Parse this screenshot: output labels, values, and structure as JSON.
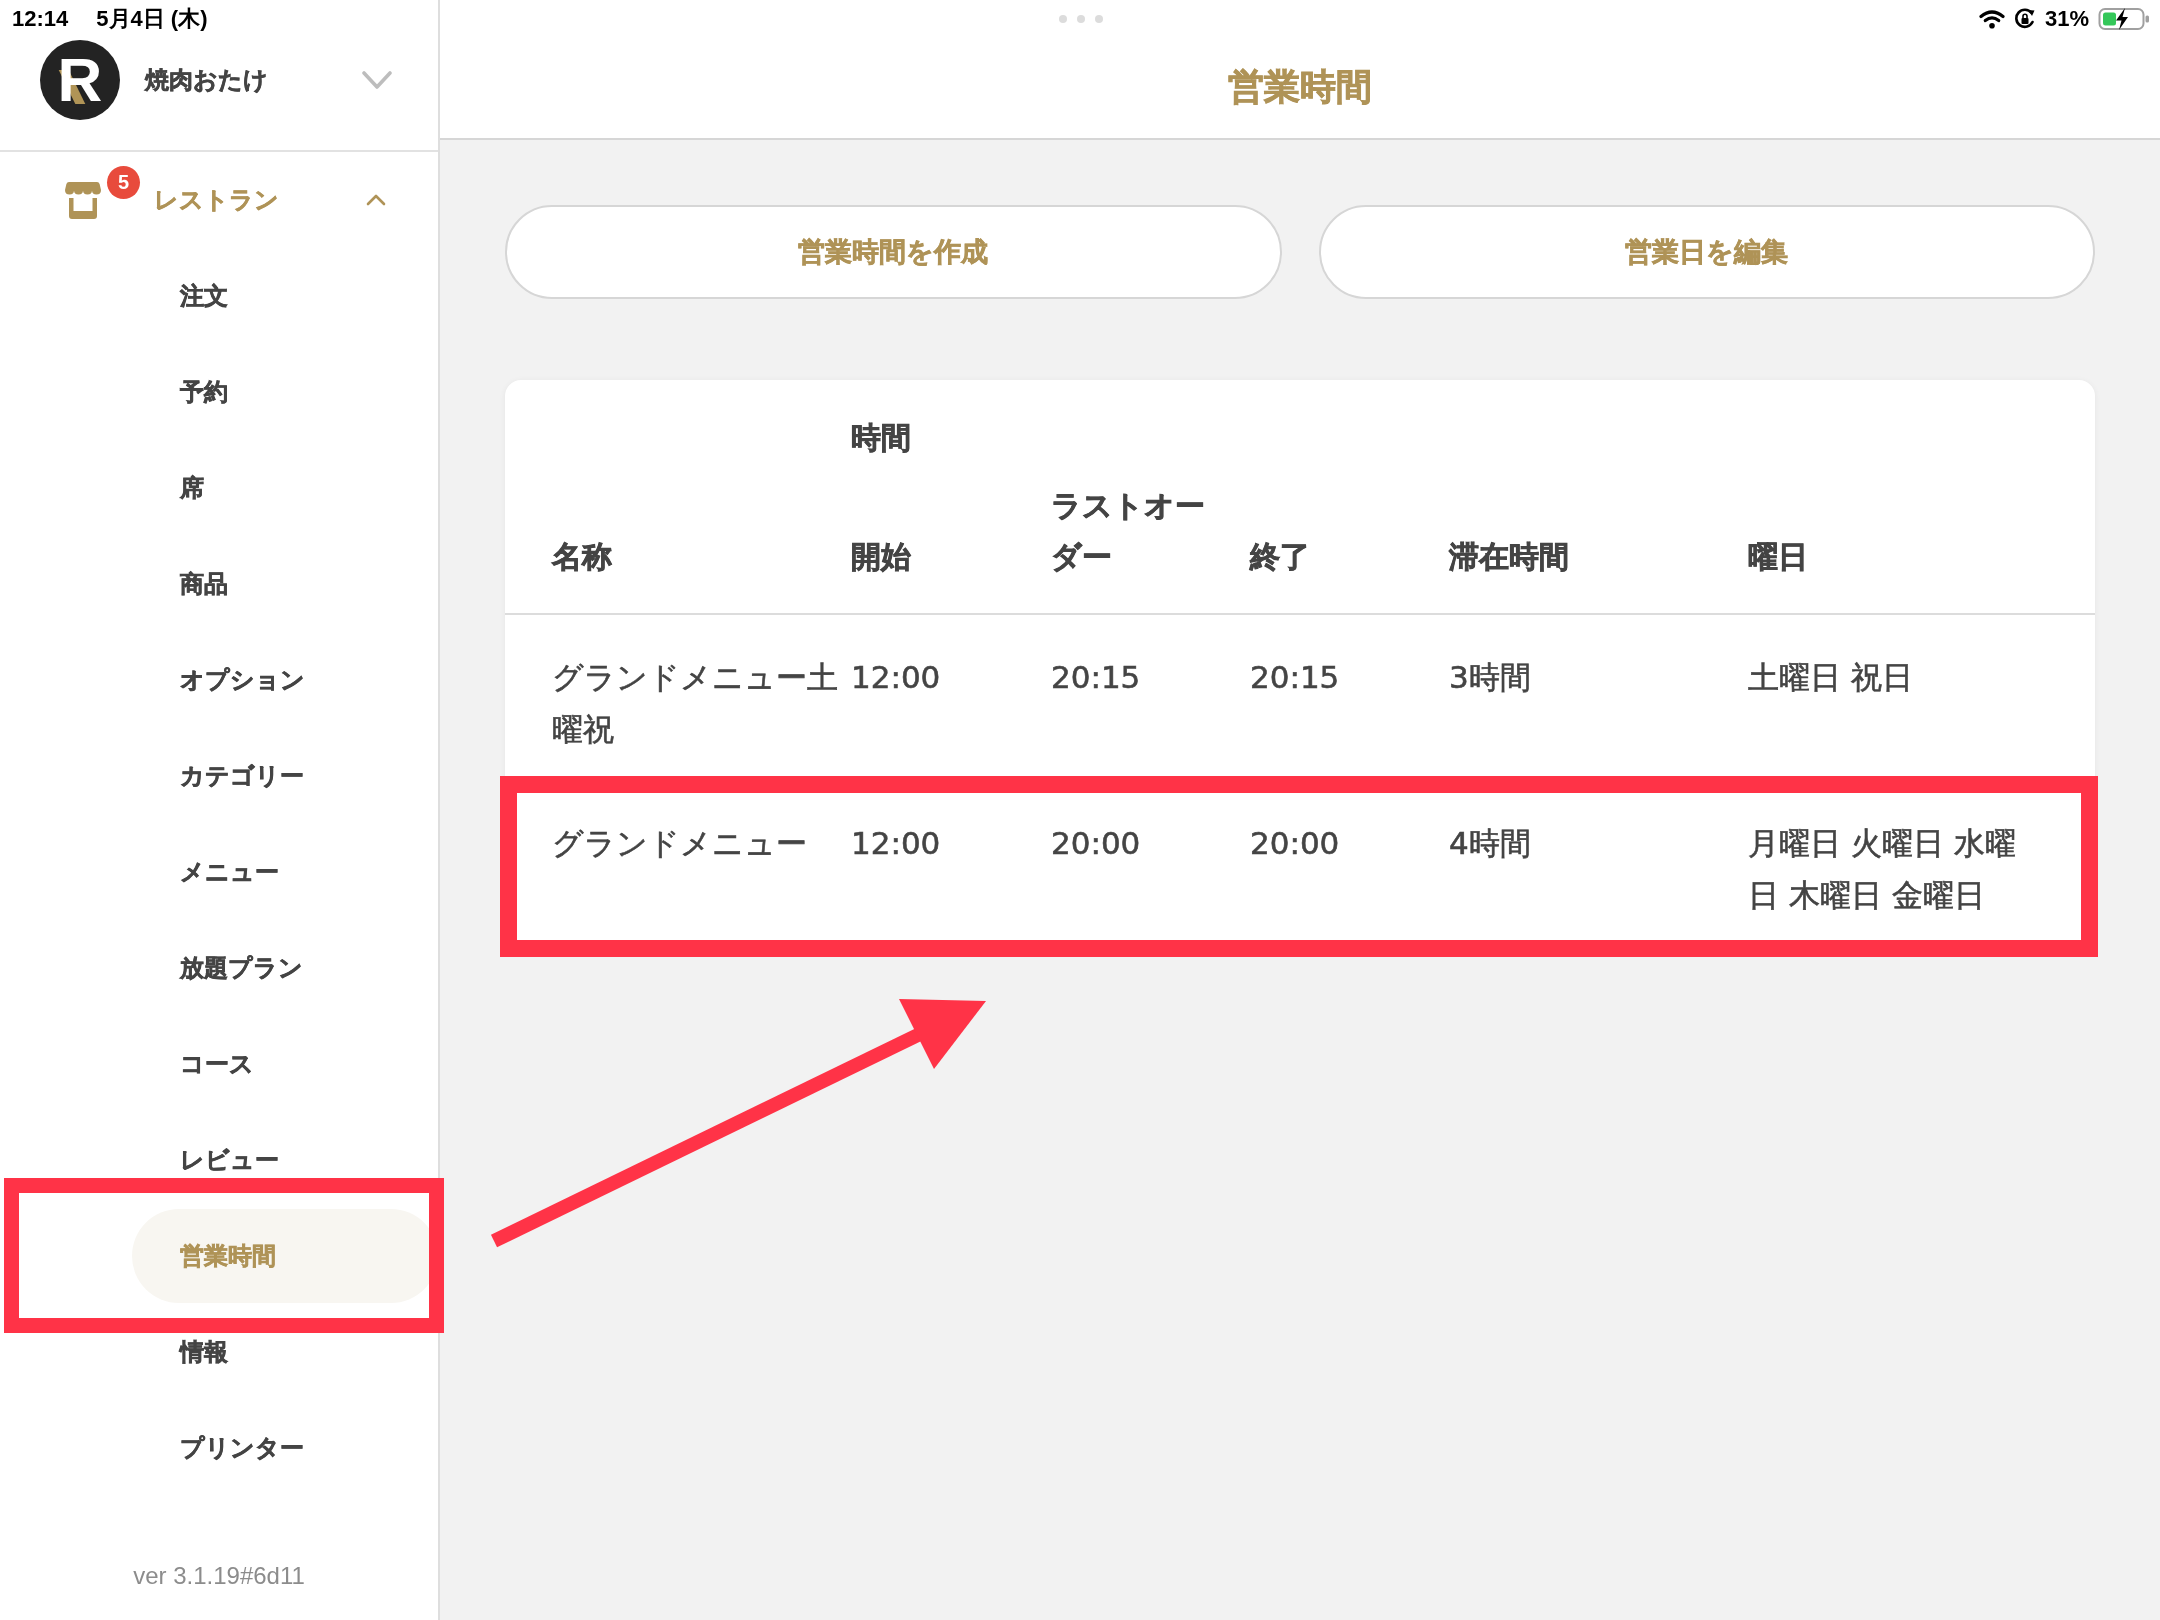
{
  "status_bar": {
    "time": "12:14",
    "date": "5月4日 (木)",
    "battery": "31%"
  },
  "sidebar": {
    "logo_mark": "R",
    "store_name": "焼肉おたけ",
    "section": {
      "label": "レストラン",
      "badge": "5",
      "expanded": true,
      "items": [
        {
          "label": "注文",
          "selected": false,
          "highlighted": false
        },
        {
          "label": "予約",
          "selected": false,
          "highlighted": false
        },
        {
          "label": "席",
          "selected": false,
          "highlighted": false
        },
        {
          "label": "商品",
          "selected": false,
          "highlighted": false
        },
        {
          "label": "オプション",
          "selected": false,
          "highlighted": false
        },
        {
          "label": "カテゴリー",
          "selected": false,
          "highlighted": false
        },
        {
          "label": "メニュー",
          "selected": false,
          "highlighted": false
        },
        {
          "label": "放題プラン",
          "selected": false,
          "highlighted": false
        },
        {
          "label": "コース",
          "selected": false,
          "highlighted": false
        },
        {
          "label": "レビュー",
          "selected": false,
          "highlighted": false
        },
        {
          "label": "営業時間",
          "selected": true,
          "highlighted": true
        },
        {
          "label": "情報",
          "selected": false,
          "highlighted": false
        },
        {
          "label": "プリンター",
          "selected": false,
          "highlighted": false
        }
      ]
    },
    "version": "ver 3.1.19#6d11"
  },
  "header": {
    "title": "営業時間"
  },
  "actions": [
    {
      "label": "営業時間を作成"
    },
    {
      "label": "営業日を編集"
    }
  ],
  "table": {
    "column_group": "時間",
    "columns": [
      "名称",
      "開始",
      "ラストオーダー",
      "終了",
      "滞在時間",
      "曜日"
    ],
    "rows": [
      {
        "cells": [
          "グランドメニュー土曜祝",
          "12:00",
          "20:15",
          "20:15",
          "3時間",
          "土曜日 祝日"
        ],
        "highlighted": false
      },
      {
        "cells": [
          "グランドメニュー",
          "12:00",
          "20:00",
          "20:00",
          "4時間",
          "月曜日 火曜日 水曜日 木曜日 金曜日"
        ],
        "highlighted": true
      }
    ]
  },
  "annotation_arrow": true
}
